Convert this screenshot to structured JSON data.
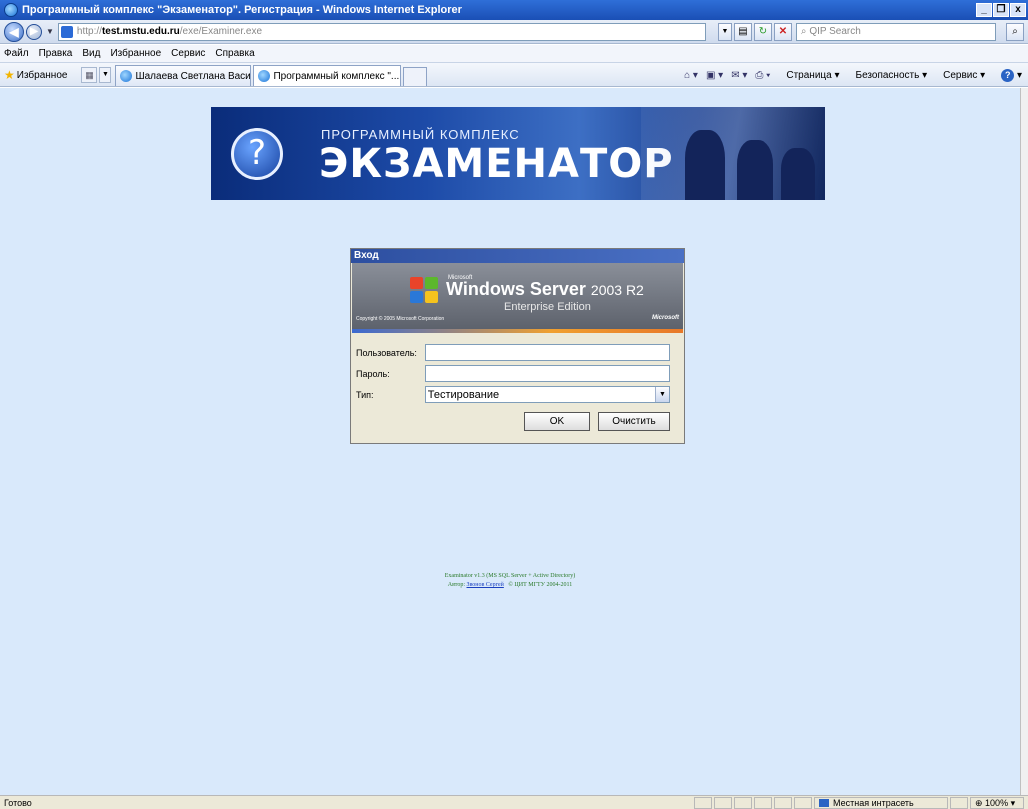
{
  "window": {
    "title": "Программный комплекс \"Экзаменатор\". Регистрация - Windows Internet Explorer",
    "minimize": "_",
    "restore": "❐",
    "close": "x"
  },
  "address": {
    "prefix": "http://",
    "host": "test.mstu.edu.ru",
    "path": "/exe/Examiner.exe",
    "search_placeholder": "QIP Search"
  },
  "menu": {
    "items": [
      "Файл",
      "Правка",
      "Вид",
      "Избранное",
      "Сервис",
      "Справка"
    ]
  },
  "favorites": {
    "label": "Избранное"
  },
  "tabs": [
    {
      "label": "Шалаева Светлана Василь...",
      "active": false
    },
    {
      "label": "Программный комплекс \"...",
      "active": true,
      "close": "x"
    }
  ],
  "commands": {
    "page": "Страница",
    "safety": "Безопасность",
    "tools": "Сервис"
  },
  "banner": {
    "subtitle": "ПРОГРАММНЫЙ КОМПЛЕКС",
    "title": "ЭКЗАМЕНАТОР",
    "symbol": "?"
  },
  "login": {
    "dialog_title": "Вход",
    "ms_label": "Microsoft",
    "product": "Windows Server",
    "version": "2003 R2",
    "edition": "Enterprise Edition",
    "copyright": "Copyright © 2005 Microsoft Corporation",
    "ms_logo": "Microsoft",
    "user_label": "Пользователь:",
    "user_value": "",
    "password_label": "Пароль:",
    "password_value": "",
    "type_label": "Тип:",
    "type_value": "Тестирование",
    "ok_label": "OK",
    "clear_label": "Очистить"
  },
  "footer": {
    "line1": "Examinator v1.3 (MS SQL Server + Active Directory)",
    "author_label": "Автор:",
    "author_name": "Звонов Сергей",
    "copyright": "© ЦИТ МГТУ 2004-2011"
  },
  "status": {
    "text": "Готово",
    "zone": "Местная интрасеть",
    "zoom": "100%"
  },
  "colors": {
    "page_bg": "#d9e9fb",
    "footer_text": "#2a7a2a",
    "link": "#1a3fbf"
  }
}
